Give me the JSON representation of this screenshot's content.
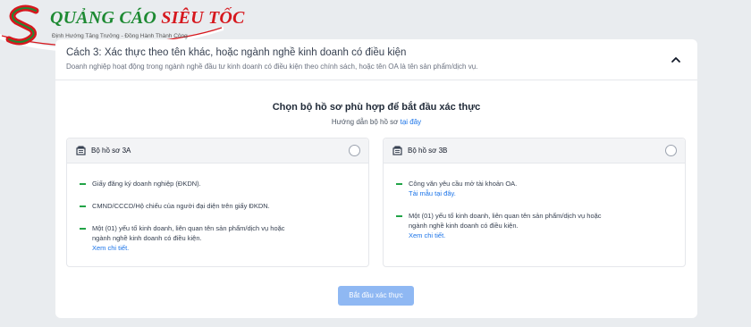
{
  "logo": {
    "brand_part1": "QUẢNG CÁO ",
    "brand_part2": "SIÊU TỐC",
    "tagline": "Định Hướng Tăng Trưởng - Đồng Hành Thành Công",
    "colors": {
      "green": "#1e8a33",
      "red": "#d6181e"
    }
  },
  "header": {
    "title": "Cách 3: Xác thực theo tên khác, hoặc ngành nghề kinh doanh có điều kiện",
    "description": "Doanh nghiệp hoạt động trong ngành nghề đầu tư kinh doanh có điều kiện theo chính sách, hoặc tên OA là tên sản phẩm/dịch vụ.",
    "collapse_icon": "chevron-up-icon"
  },
  "main": {
    "section_title": "Chọn bộ hồ sơ phù hợp để bắt đầu xác thực",
    "guide_text": "Hướng dẫn bộ hồ sơ ",
    "guide_link": "tại đây"
  },
  "options": [
    {
      "label": "Bộ hồ sơ 3A",
      "icon": "document-stack-icon",
      "items": [
        {
          "text": "Giấy đăng ký doanh nghiệp (ĐKDN)."
        },
        {
          "text": "CMND/CCCD/Hộ chiếu của người đại diện trên giấy ĐKDN."
        },
        {
          "text": "Một (01) yếu tố kinh doanh, liên quan tên sản phẩm/dịch vụ hoặc",
          "text2": "ngành nghề kinh doanh có điều kiện.",
          "link": "Xem chi tiết."
        }
      ]
    },
    {
      "label": "Bộ hồ sơ 3B",
      "icon": "document-stack-icon",
      "items": [
        {
          "text": "Công văn yêu cầu mở tài khoản OA.",
          "link": "Tải mẫu tại đây."
        },
        {
          "text": "Một (01) yếu tố kinh doanh, liên quan tên sản phẩm/dịch vụ hoặc",
          "text2": "ngành nghề kinh doanh có điều kiện.",
          "link": "Xem chi tiết."
        }
      ]
    }
  ],
  "start_button": {
    "label": "Bắt đầu xác thực",
    "color": "#8fb8f3"
  },
  "colors": {
    "link": "#1a73e8",
    "bullet": "#22a447",
    "background": "#e9ecef"
  }
}
